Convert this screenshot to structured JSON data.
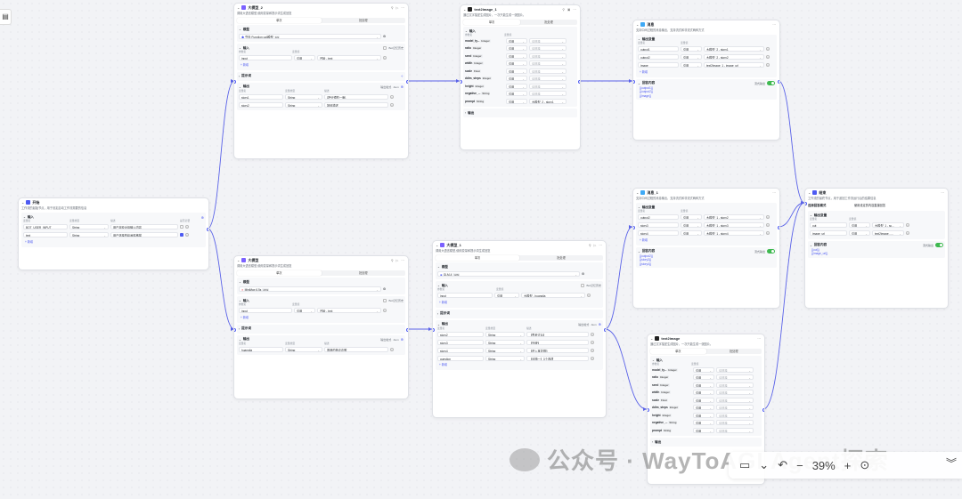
{
  "start": {
    "title": "开始",
    "desc": "工作流的起始节点，用于设定启动工作流需要的信息",
    "input_label": "输入",
    "cols": [
      "变量名",
      "变量类型",
      "描述",
      "是否必要"
    ],
    "rows": [
      {
        "name": "BOT_USER_INPUT",
        "type": "String",
        "desc": "用户本轮对话输入内容"
      },
      {
        "name": "text",
        "type": "String",
        "desc": "用户选择的绘画风格描"
      }
    ],
    "add": "新增"
  },
  "llm2": {
    "title": "大模型_2",
    "desc": "调用大语言模型,使用变量和提示词生成回复",
    "tabs": [
      "单次",
      "批处理"
    ],
    "model_label": "模型",
    "model": "豆包·Function call模型",
    "model_tag": "32k",
    "input_label": "输入",
    "bg": "Bot记忆历史",
    "input_cols": [
      "参数名",
      "变量值"
    ],
    "input_row": {
      "name": "input",
      "ref": "引用",
      "val": "开始 - text"
    },
    "add": "新增",
    "prompt_label": "提示词",
    "output_label": "输出",
    "output_fmt": "输出格式",
    "fmt": "Json",
    "out_cols": [
      "变量名",
      "变量类型",
      "描述"
    ],
    "out_rows": [
      {
        "name": "story1",
        "type": "String",
        "desc": "{把分镜的一面}"
      },
      {
        "name": "story2",
        "type": "String",
        "desc": "场景描述"
      }
    ]
  },
  "llm": {
    "title": "大模型",
    "desc": "调用大语言模型,使用变量和提示词生成回复",
    "tabs": [
      "单次",
      "批处理"
    ],
    "model_label": "模型",
    "model": "MiniMax 6.5s",
    "model_tag": "245k",
    "input_label": "输入",
    "bg": "Bot记忆历史",
    "input_cols": [
      "参数名",
      "变量值"
    ],
    "input_row": {
      "name": "input",
      "ref": "引用",
      "val": "开始 - text"
    },
    "add": "新增",
    "prompt_label": "提示词",
    "output_label": "输出",
    "output_fmt": "输出格式",
    "fmt": "Json",
    "out_cols": [
      "变量名",
      "变量类型",
      "描述"
    ],
    "out_rows": [
      {
        "name": "huangjia",
        "type": "String",
        "desc": "香港的黄嘉嘉歌"
      }
    ]
  },
  "t2i1": {
    "title": "text2image_1",
    "desc": "通过文字描述生成图片，一次只能生成一张图片。",
    "tabs": [
      "单次",
      "批处理"
    ],
    "input_label": "输入",
    "cols": [
      "参数名",
      "变量值"
    ],
    "rows": [
      {
        "name": "model_ty...",
        "type": "Integer",
        "ref": "引用",
        "val": "请选择"
      },
      {
        "name": "ratio",
        "type": "Integer",
        "ref": "引用",
        "val": "请选择"
      },
      {
        "name": "seed",
        "type": "Integer",
        "ref": "引用",
        "val": "请选择"
      },
      {
        "name": "width",
        "type": "Integer",
        "ref": "引用",
        "val": "请选择"
      },
      {
        "name": "scale",
        "type": "Float",
        "ref": "引用",
        "val": "请选择"
      },
      {
        "name": "ddim_steps",
        "type": "Integer",
        "ref": "引用",
        "val": "请选择"
      },
      {
        "name": "height",
        "type": "Integer",
        "ref": "引用",
        "val": "请选择"
      },
      {
        "name": "negative_...",
        "type": "String",
        "ref": "引用",
        "val": "请选择"
      },
      {
        "name": "prompt",
        "type": "String",
        "ref": "引用",
        "val": "大模型_2 - story1"
      }
    ],
    "output_label": "输出"
  },
  "t2i": {
    "title": "text2image",
    "desc": "通过文字描述生成图片，一次只能生成一张图片。",
    "tabs": [
      "单次",
      "批处理"
    ],
    "input_label": "输入",
    "cols": [
      "参数名",
      "变量值"
    ],
    "rows": [
      {
        "name": "model_ty...",
        "type": "Integer",
        "ref": "引用",
        "val": "请选择"
      },
      {
        "name": "ratio",
        "type": "Integer",
        "ref": "引用",
        "val": "请选择"
      },
      {
        "name": "seed",
        "type": "Integer",
        "ref": "引用",
        "val": "请选择"
      },
      {
        "name": "width",
        "type": "Integer",
        "ref": "引用",
        "val": "请选择"
      },
      {
        "name": "scale",
        "type": "Float",
        "ref": "引用",
        "val": "请选择"
      },
      {
        "name": "ddim_steps",
        "type": "Integer",
        "ref": "引用",
        "val": "请选择"
      },
      {
        "name": "height",
        "type": "Integer",
        "ref": "引用",
        "val": "请选择"
      },
      {
        "name": "negative_...",
        "type": "String",
        "ref": "引用",
        "val": "请选择"
      },
      {
        "name": "prompt",
        "type": "String",
        "ref": "引用",
        "val": "请选择"
      }
    ],
    "output_label": "输出"
  },
  "llm1": {
    "title": "大模型_1",
    "desc": "调用大语言模型,使用变量和提示词生成回复",
    "tabs": [
      "单次",
      "批处理"
    ],
    "model_label": "模型",
    "model": "GLM-4",
    "model_tag": "128k",
    "input_label": "输入",
    "bg": "Bot记忆历史",
    "input_cols": [
      "参数名",
      "变量值"
    ],
    "input_row": {
      "name": "input",
      "ref": "引用",
      "val": "大模型 - huangjia"
    },
    "add": "新增",
    "prompt_label": "提示词",
    "output_label": "输出",
    "output_fmt": "输出格式",
    "fmt": "Json",
    "out_cols": [
      "变量名",
      "变量类型",
      "描述"
    ],
    "out_rows": [
      {
        "name": "story2",
        "type": "String",
        "desc": "【思考过后】"
      },
      {
        "name": "story3",
        "type": "String",
        "desc": "【外貌】"
      },
      {
        "name": "story4",
        "type": "String",
        "desc": "【进入某花园】"
      },
      {
        "name": "question",
        "type": "String",
        "desc": "【问题一】3个选项"
      }
    ]
  },
  "msg": {
    "title": "消息",
    "desc": "支持中间过程的消息输出，支持流式和非流式两种方式",
    "out_label": "输出变量",
    "cols": [
      "变量名",
      "变量值"
    ],
    "rows": [
      {
        "name": "output1",
        "ref": "引用",
        "val": "大模型_2 - story1"
      },
      {
        "name": "output2",
        "ref": "引用",
        "val": "大模型_2 - story2"
      },
      {
        "name": "image",
        "ref": "引用",
        "val": "text2image_1 - image_url"
      }
    ],
    "add": "新增",
    "content_label": "回答内容",
    "stream": "流式输出",
    "vars": [
      "{{output1}}",
      "{{output2}}",
      "{{image}}"
    ]
  },
  "msg1": {
    "title": "消息_1",
    "desc": "支持中间过程的消息输出，支持流式和非流式两种方式",
    "out_label": "输出变量",
    "cols": [
      "变量名",
      "变量值"
    ],
    "rows": [
      {
        "name": "output2",
        "ref": "引用",
        "val": "大模型_1 - story2"
      },
      {
        "name": "story3",
        "ref": "引用",
        "val": "大模型_1 - story3"
      },
      {
        "name": "story4",
        "ref": "引用",
        "val": "大模型_1 - story4"
      }
    ],
    "add": "新增",
    "content_label": "回答内容",
    "stream": "流式输出",
    "vars": [
      "{{output2}}",
      "{{story3}}",
      "{{story4}}"
    ]
  },
  "end": {
    "title": "结束",
    "desc": "工作流的最终节点，用于返回工作流运行后的结果信息",
    "mode_label": "选择回答模式",
    "mode_val": "使用设定的内容直接回答",
    "out_label": "输出变量",
    "cols": [
      "变量名",
      "变量值"
    ],
    "rows": [
      {
        "name": "out",
        "ref": "引用",
        "val": "大模型_1 - sc..."
      },
      {
        "name": "image_url",
        "ref": "引用",
        "val": "text2image - ..."
      }
    ],
    "content_label": "回答内容",
    "stream": "流式输出",
    "vars": [
      "{{out}}",
      "{{image_url}}"
    ]
  },
  "watermark": "公众号 · WayToAGI Agent探索",
  "toolbar": {
    "zoom": "39%"
  },
  "colors": {
    "accent": "#4e5bf2",
    "toggle": "#3fb950"
  }
}
